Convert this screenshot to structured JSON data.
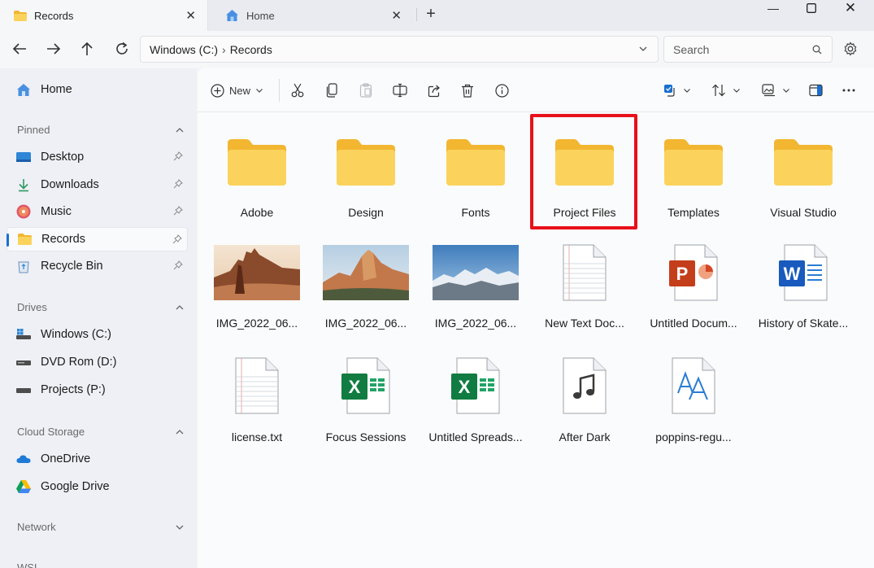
{
  "tabs": [
    {
      "label": "Records",
      "icon": "folder-icon",
      "active": true
    },
    {
      "label": "Home",
      "icon": "home-icon",
      "active": false
    }
  ],
  "address": {
    "root": "Windows (C:)",
    "current": "Records"
  },
  "search": {
    "placeholder": "Search"
  },
  "sidebar": {
    "home": "Home",
    "pinned_header": "Pinned",
    "pinned": [
      {
        "label": "Desktop",
        "icon": "desktop-icon"
      },
      {
        "label": "Downloads",
        "icon": "download-icon"
      },
      {
        "label": "Music",
        "icon": "music-icon"
      },
      {
        "label": "Records",
        "icon": "folder-icon",
        "selected": true
      },
      {
        "label": "Recycle Bin",
        "icon": "recycle-bin-icon"
      }
    ],
    "drives_header": "Drives",
    "drives": [
      {
        "label": "Windows (C:)",
        "icon": "windows-drive-icon"
      },
      {
        "label": "DVD Rom (D:)",
        "icon": "dvd-drive-icon"
      },
      {
        "label": "Projects (P:)",
        "icon": "drive-icon"
      }
    ],
    "cloud_header": "Cloud Storage",
    "cloud": [
      {
        "label": "OneDrive",
        "icon": "onedrive-icon"
      },
      {
        "label": "Google Drive",
        "icon": "google-drive-icon"
      }
    ],
    "network_header": "Network",
    "wsl_header": "WSL"
  },
  "toolbar": {
    "new_label": "New"
  },
  "files": [
    {
      "name": "Adobe",
      "type": "folder"
    },
    {
      "name": "Design",
      "type": "folder"
    },
    {
      "name": "Fonts",
      "type": "folder"
    },
    {
      "name": "Project Files",
      "type": "folder",
      "highlighted": true
    },
    {
      "name": "Templates",
      "type": "folder"
    },
    {
      "name": "Visual Studio",
      "type": "folder"
    },
    {
      "name": "IMG_2022_06...",
      "type": "image-desert"
    },
    {
      "name": "IMG_2022_06...",
      "type": "image-mountain"
    },
    {
      "name": "IMG_2022_06...",
      "type": "image-snow"
    },
    {
      "name": "New Text Doc...",
      "type": "text"
    },
    {
      "name": "Untitled Docum...",
      "type": "powerpoint"
    },
    {
      "name": "History of Skate...",
      "type": "word"
    },
    {
      "name": "license.txt",
      "type": "text"
    },
    {
      "name": "Focus Sessions",
      "type": "excel"
    },
    {
      "name": "Untitled Spreads...",
      "type": "excel"
    },
    {
      "name": "After Dark",
      "type": "audio"
    },
    {
      "name": "poppins-regu...",
      "type": "font"
    }
  ],
  "colors": {
    "highlight": "#e8111b",
    "accent": "#1a6fd0",
    "folder": "#f8c948"
  }
}
